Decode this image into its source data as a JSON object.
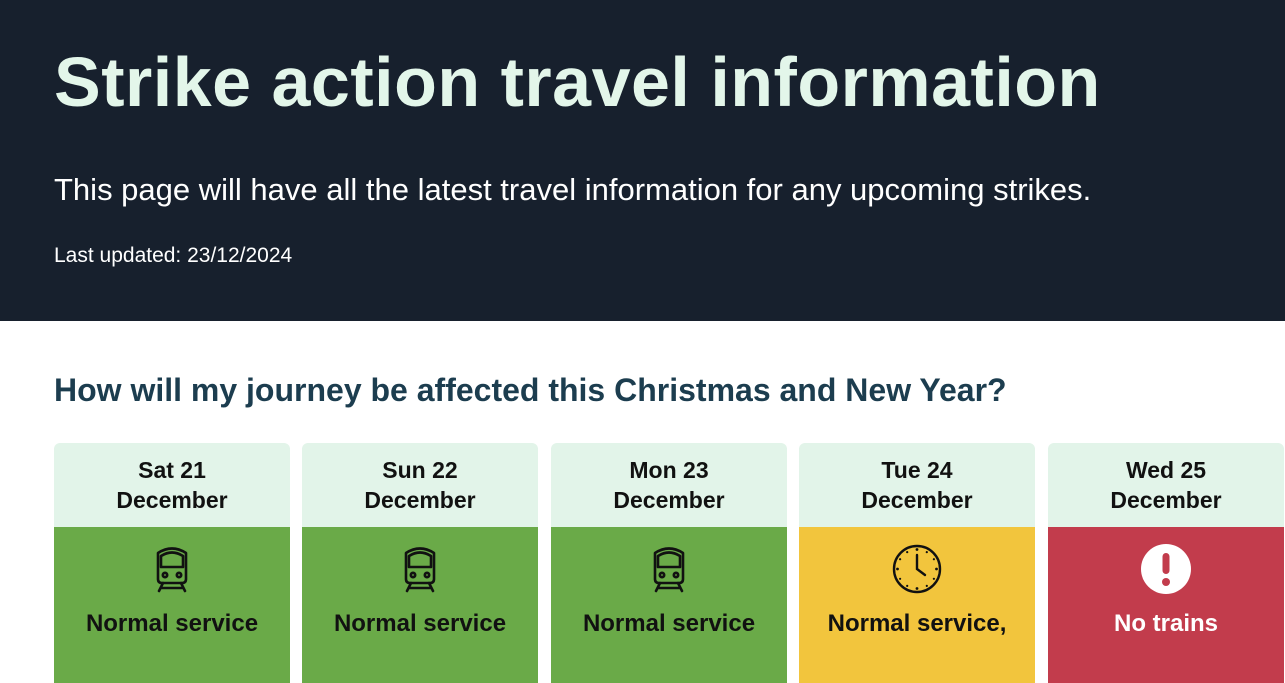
{
  "hero": {
    "title": "Strike action travel information",
    "intro": "This page will have all the latest travel information for any upcoming strikes.",
    "last_updated": "Last updated: 23/12/2024"
  },
  "section": {
    "title": "How will my journey be affected this Christmas and New Year?"
  },
  "days": [
    {
      "day": "Sat 21",
      "month": "December",
      "status": "Normal service",
      "icon": "train-icon",
      "level": "normal"
    },
    {
      "day": "Sun 22",
      "month": "December",
      "status": "Normal service",
      "icon": "train-icon",
      "level": "normal"
    },
    {
      "day": "Mon 23",
      "month": "December",
      "status": "Normal service",
      "icon": "train-icon",
      "level": "normal"
    },
    {
      "day": "Tue 24",
      "month": "December",
      "status": "Normal service,",
      "icon": "clock-icon",
      "level": "changed"
    },
    {
      "day": "Wed 25",
      "month": "December",
      "status": "No trains",
      "icon": "alert-icon",
      "level": "none"
    }
  ],
  "colors": {
    "hero_bg": "#17202d",
    "hero_title": "#e3f6ea",
    "section_title": "#1c3d4f",
    "card_head": "#e2f4e9",
    "normal": "#6aaa48",
    "changed": "#f2c53d",
    "none": "#c23c4c"
  }
}
